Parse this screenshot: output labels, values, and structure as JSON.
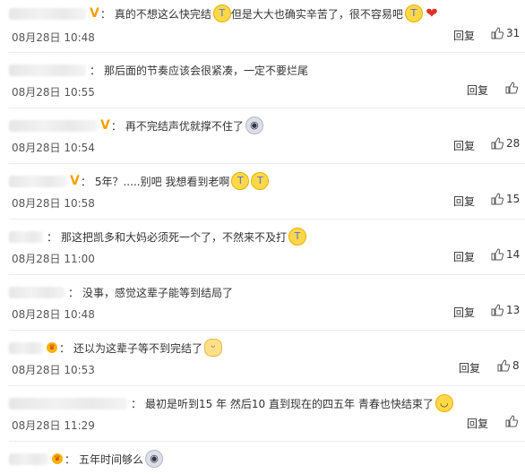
{
  "comments": [
    {
      "text": "真的不想这么快完结",
      "text2": "但是大大也确实辛苦了，很不容易吧",
      "date": "08月28日 10:48",
      "reply": "回复",
      "likes": "31"
    },
    {
      "text": "那后面的节奏应该会很紧凑，一定不要烂尾",
      "date": "08月28日 10:55",
      "reply": "回复",
      "likes": ""
    },
    {
      "text": "再不完结声优就撑不住了",
      "date": "08月28日 10:54",
      "reply": "回复",
      "likes": "28"
    },
    {
      "text": "5年？.....别吧 我想看到老啊",
      "date": "08月28日 10:58",
      "reply": "回复",
      "likes": "15"
    },
    {
      "text": "那这把凯多和大妈必须死一个了，不然来不及打",
      "date": "08月28日 11:00",
      "reply": "回复",
      "likes": "14"
    },
    {
      "text": "没事，感觉这辈子能等到结局了",
      "date": "08月28日 10:48",
      "reply": "回复",
      "likes": "13"
    },
    {
      "text": "还以为这辈子等不到完结了",
      "date": "08月28日 10:53",
      "reply": "回复",
      "likes": "8"
    },
    {
      "text": "最初是听到15 年 然后10 直到现在的四五年 青春也快结束了",
      "date": "08月28日 11:29",
      "reply": "回复",
      "likes": ""
    },
    {
      "text": "五年时间够么"
    }
  ],
  "badges": {
    "verified": "V",
    "colon": "："
  },
  "icons": {
    "thumb": "thumbs-up-icon",
    "sad": "crying-emoji",
    "heart": "heart-emoji",
    "scared": "scared-emoji",
    "cat": "cat-emoji",
    "smile": "smile-emoji"
  },
  "colors": {
    "verified": "#f5a000",
    "heart": "#e0302a",
    "separator": "#ececec"
  }
}
